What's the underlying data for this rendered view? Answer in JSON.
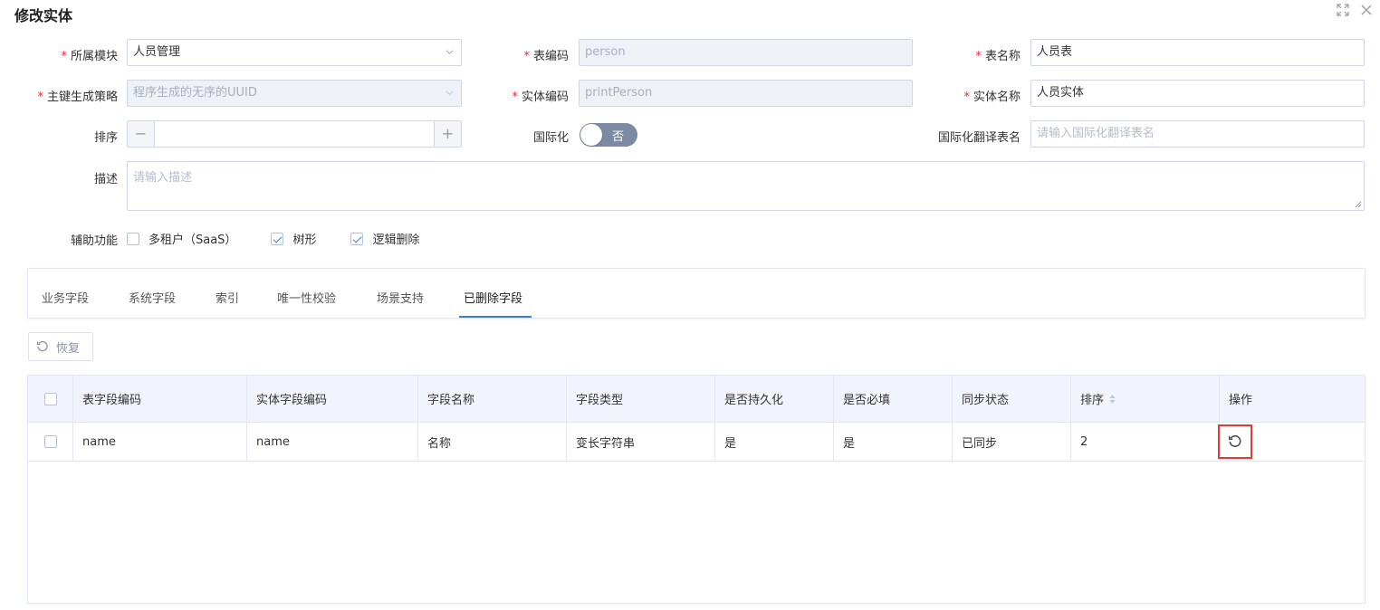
{
  "dialog": {
    "title": "修改实体"
  },
  "form": {
    "module": {
      "label": "所属模块",
      "value": "人员管理"
    },
    "table_code": {
      "label": "表编码",
      "value": "person"
    },
    "table_name": {
      "label": "表名称",
      "value": "人员表"
    },
    "pk_strategy": {
      "label": "主键生成策略",
      "value": "程序生成的无序的UUID"
    },
    "entity_code": {
      "label": "实体编码",
      "value": "printPerson"
    },
    "entity_name": {
      "label": "实体名称",
      "value": "人员实体"
    },
    "sort": {
      "label": "排序",
      "value": ""
    },
    "i18n": {
      "label": "国际化",
      "toggle_text": "否",
      "enabled": false
    },
    "i18n_table": {
      "label": "国际化翻译表名",
      "placeholder": "请输入国际化翻译表名"
    },
    "description": {
      "label": "描述",
      "placeholder": "请输入描述"
    },
    "aux": {
      "label": "辅助功能",
      "options": [
        {
          "label": "多租户（SaaS）",
          "checked": false
        },
        {
          "label": "树形",
          "checked": true
        },
        {
          "label": "逻辑删除",
          "checked": true
        }
      ]
    }
  },
  "tabs": [
    "业务字段",
    "系统字段",
    "索引",
    "唯一性校验",
    "场景支持",
    "已删除字段"
  ],
  "active_tab": "已删除字段",
  "toolbar": {
    "restore_label": "恢复"
  },
  "table": {
    "columns": [
      "表字段编码",
      "实体字段编码",
      "字段名称",
      "字段类型",
      "是否持久化",
      "是否必填",
      "同步状态",
      "排序",
      "操作"
    ],
    "rows": [
      [
        "name",
        "name",
        "名称",
        "变长字符串",
        "是",
        "是",
        "已同步",
        "2"
      ]
    ]
  },
  "colors": {
    "accent": "#3a7fd5",
    "highlight": "#e53935",
    "toggle_off": "#7d8aa3"
  }
}
